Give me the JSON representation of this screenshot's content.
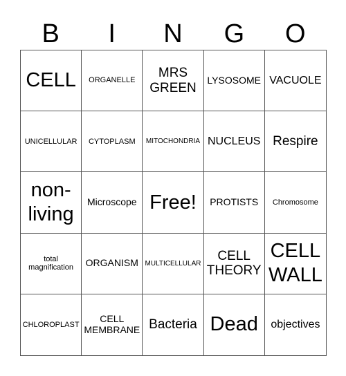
{
  "title_letters": [
    "B",
    "I",
    "N",
    "G",
    "O"
  ],
  "cells": [
    {
      "text": "CELL",
      "size": "s-xl"
    },
    {
      "text": "ORGANELLE",
      "size": "s-s"
    },
    {
      "text": "MRS GREEN",
      "size": "s-l"
    },
    {
      "text": "LYSOSOME",
      "size": "s-m"
    },
    {
      "text": "VACUOLE",
      "size": "s-ml"
    },
    {
      "text": "UNICELLULAR",
      "size": "s-s"
    },
    {
      "text": "CYTOPLASM",
      "size": "s-s"
    },
    {
      "text": "MITOCHONDRIA",
      "size": "s-xs"
    },
    {
      "text": "NUCLEUS",
      "size": "s-ml"
    },
    {
      "text": "Respire",
      "size": "s-l"
    },
    {
      "text": "non-living",
      "size": "s-xl"
    },
    {
      "text": "Microscope",
      "size": "s-m"
    },
    {
      "text": "Free!",
      "size": "s-xl"
    },
    {
      "text": "PROTISTS",
      "size": "s-m"
    },
    {
      "text": "Chromosome",
      "size": "s-s"
    },
    {
      "text": "total magnification",
      "size": "s-s"
    },
    {
      "text": "ORGANISM",
      "size": "s-m"
    },
    {
      "text": "MULTICELLULAR",
      "size": "s-xs"
    },
    {
      "text": "CELL THEORY",
      "size": "s-l"
    },
    {
      "text": "CELL WALL",
      "size": "s-xl"
    },
    {
      "text": "CHLOROPLAST",
      "size": "s-s"
    },
    {
      "text": "CELL MEMBRANE",
      "size": "s-m"
    },
    {
      "text": "Bacteria",
      "size": "s-l"
    },
    {
      "text": "Dead",
      "size": "s-xl"
    },
    {
      "text": "objectives",
      "size": "s-ml"
    }
  ]
}
